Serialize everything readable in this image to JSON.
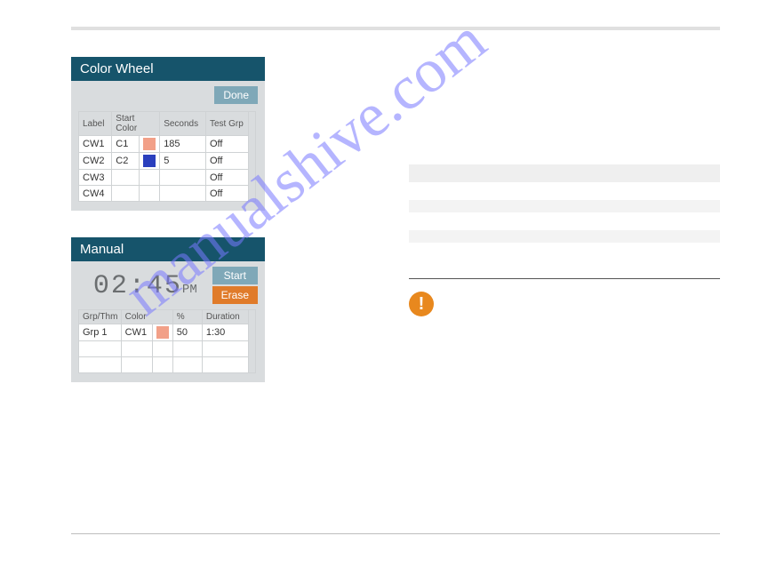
{
  "watermark": "manualshive.com",
  "colorWheel": {
    "title": "Color Wheel",
    "doneLabel": "Done",
    "headers": {
      "label": "Label",
      "startColor": "Start Color",
      "seconds": "Seconds",
      "testGrp": "Test Grp"
    },
    "rows": [
      {
        "label": "CW1",
        "startColor": "C1",
        "swatch": "#f2a088",
        "seconds": "185",
        "testGrp": "Off"
      },
      {
        "label": "CW2",
        "startColor": "C2",
        "swatch": "#2a3fbd",
        "seconds": "5",
        "testGrp": "Off"
      },
      {
        "label": "CW3",
        "startColor": "",
        "swatch": "",
        "seconds": "",
        "testGrp": "Off"
      },
      {
        "label": "CW4",
        "startColor": "",
        "swatch": "",
        "seconds": "",
        "testGrp": "Off"
      }
    ]
  },
  "manual": {
    "title": "Manual",
    "clockTime": "02:45",
    "clockPeriod": "PM",
    "startLabel": "Start",
    "eraseLabel": "Erase",
    "headers": {
      "grpThm": "Grp/Thm",
      "color": "Color",
      "pct": "%",
      "duration": "Duration"
    },
    "rows": [
      {
        "grpThm": "Grp 1",
        "color": "CW1",
        "swatch": "#f2a088",
        "pct": "50",
        "duration": "1:30"
      },
      {
        "grpThm": "",
        "color": "",
        "swatch": "",
        "pct": "",
        "duration": ""
      },
      {
        "grpThm": "",
        "color": "",
        "swatch": "",
        "pct": "",
        "duration": ""
      }
    ]
  },
  "warnGlyph": "!"
}
